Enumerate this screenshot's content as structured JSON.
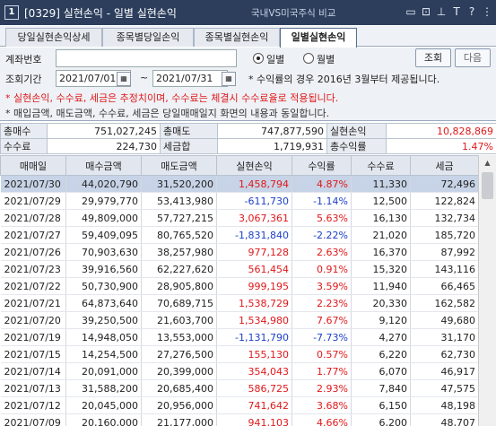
{
  "window": {
    "number": "1",
    "title": "[0329] 실현손익 - 일별 실현손익",
    "compare_link": "국내VS미국주식 비교",
    "icons": [
      "split-icon",
      "lock-icon",
      "pin-icon",
      "text-size-icon",
      "help-icon",
      "more-icon"
    ]
  },
  "tabs": [
    {
      "label": "당일실현손익상세"
    },
    {
      "label": "종목별당일손익"
    },
    {
      "label": "종목별실현손익"
    },
    {
      "label": "일별실현손익"
    }
  ],
  "filter": {
    "account_label": "계좌번호",
    "account_value": "",
    "radio_daily": "일별",
    "radio_monthly": "월별",
    "selected": "일별",
    "search_button": "조회",
    "next_button": "다음",
    "period_label": "조회기간",
    "date_from": "2021/07/01",
    "date_sep": "~",
    "date_to": "2021/07/31",
    "yield_note": "* 수익률의 경우 2016년 3월부터 제공됩니다."
  },
  "notes": [
    "* 실현손익, 수수료, 세금은 추정치이며, 수수료는 체결시 수수료율로 적용됩니다.",
    "* 매입금액, 매도금액, 수수료, 세금은 당일매매일지 화면의 내용과 동일합니다."
  ],
  "summary": {
    "total_buy_label": "총매수",
    "total_buy": "751,027,245",
    "total_sell_label": "총매도",
    "total_sell": "747,877,590",
    "realized_label": "실현손익",
    "realized": "10,828,869",
    "fee_label": "수수료",
    "fee": "224,730",
    "tax_label": "세금합",
    "tax": "1,719,931",
    "yield_label": "총수익률",
    "yield": "1.47%"
  },
  "table": {
    "columns": [
      "매매일",
      "매수금액",
      "매도금액",
      "실현손익",
      "수익률",
      "수수료",
      "세금"
    ],
    "rows": [
      {
        "date": "2021/07/30",
        "buy": "44,020,790",
        "sell": "31,520,200",
        "pnl": "1,458,794",
        "rate": "4.87%",
        "fee": "11,330",
        "tax": "72,496",
        "sign": "pos"
      },
      {
        "date": "2021/07/29",
        "buy": "29,979,770",
        "sell": "53,413,980",
        "pnl": "-611,730",
        "rate": "-1.14%",
        "fee": "12,500",
        "tax": "122,824",
        "sign": "neg"
      },
      {
        "date": "2021/07/28",
        "buy": "49,809,000",
        "sell": "57,727,215",
        "pnl": "3,067,361",
        "rate": "5.63%",
        "fee": "16,130",
        "tax": "132,734",
        "sign": "pos"
      },
      {
        "date": "2021/07/27",
        "buy": "59,409,095",
        "sell": "80,765,520",
        "pnl": "-1,831,840",
        "rate": "-2.22%",
        "fee": "21,020",
        "tax": "185,720",
        "sign": "neg"
      },
      {
        "date": "2021/07/26",
        "buy": "70,903,630",
        "sell": "38,257,980",
        "pnl": "977,128",
        "rate": "2.63%",
        "fee": "16,370",
        "tax": "87,992",
        "sign": "pos"
      },
      {
        "date": "2021/07/23",
        "buy": "39,916,560",
        "sell": "62,227,620",
        "pnl": "561,454",
        "rate": "0.91%",
        "fee": "15,320",
        "tax": "143,116",
        "sign": "pos"
      },
      {
        "date": "2021/07/22",
        "buy": "50,730,900",
        "sell": "28,905,800",
        "pnl": "999,195",
        "rate": "3.59%",
        "fee": "11,940",
        "tax": "66,465",
        "sign": "pos"
      },
      {
        "date": "2021/07/21",
        "buy": "64,873,640",
        "sell": "70,689,715",
        "pnl": "1,538,729",
        "rate": "2.23%",
        "fee": "20,330",
        "tax": "162,582",
        "sign": "pos"
      },
      {
        "date": "2021/07/20",
        "buy": "39,250,500",
        "sell": "21,603,700",
        "pnl": "1,534,980",
        "rate": "7.67%",
        "fee": "9,120",
        "tax": "49,680",
        "sign": "pos"
      },
      {
        "date": "2021/07/19",
        "buy": "14,948,050",
        "sell": "13,553,000",
        "pnl": "-1,131,790",
        "rate": "-7.73%",
        "fee": "4,270",
        "tax": "31,170",
        "sign": "neg"
      },
      {
        "date": "2021/07/15",
        "buy": "14,254,500",
        "sell": "27,276,500",
        "pnl": "155,130",
        "rate": "0.57%",
        "fee": "6,220",
        "tax": "62,730",
        "sign": "pos"
      },
      {
        "date": "2021/07/14",
        "buy": "20,091,000",
        "sell": "20,399,000",
        "pnl": "354,043",
        "rate": "1.77%",
        "fee": "6,070",
        "tax": "46,917",
        "sign": "pos"
      },
      {
        "date": "2021/07/13",
        "buy": "31,588,200",
        "sell": "20,685,400",
        "pnl": "586,725",
        "rate": "2.93%",
        "fee": "7,840",
        "tax": "47,575",
        "sign": "pos"
      },
      {
        "date": "2021/07/12",
        "buy": "20,045,000",
        "sell": "20,956,000",
        "pnl": "741,642",
        "rate": "3.68%",
        "fee": "6,150",
        "tax": "48,198",
        "sign": "pos"
      },
      {
        "date": "2021/07/09",
        "buy": "20,160,000",
        "sell": "21,177,000",
        "pnl": "941,103",
        "rate": "4.66%",
        "fee": "6,200",
        "tax": "48,707",
        "sign": "pos"
      }
    ]
  },
  "colors": {
    "positive": "#e0181a",
    "negative": "#1c3fc8",
    "titlebar": "#2c3e5c"
  }
}
